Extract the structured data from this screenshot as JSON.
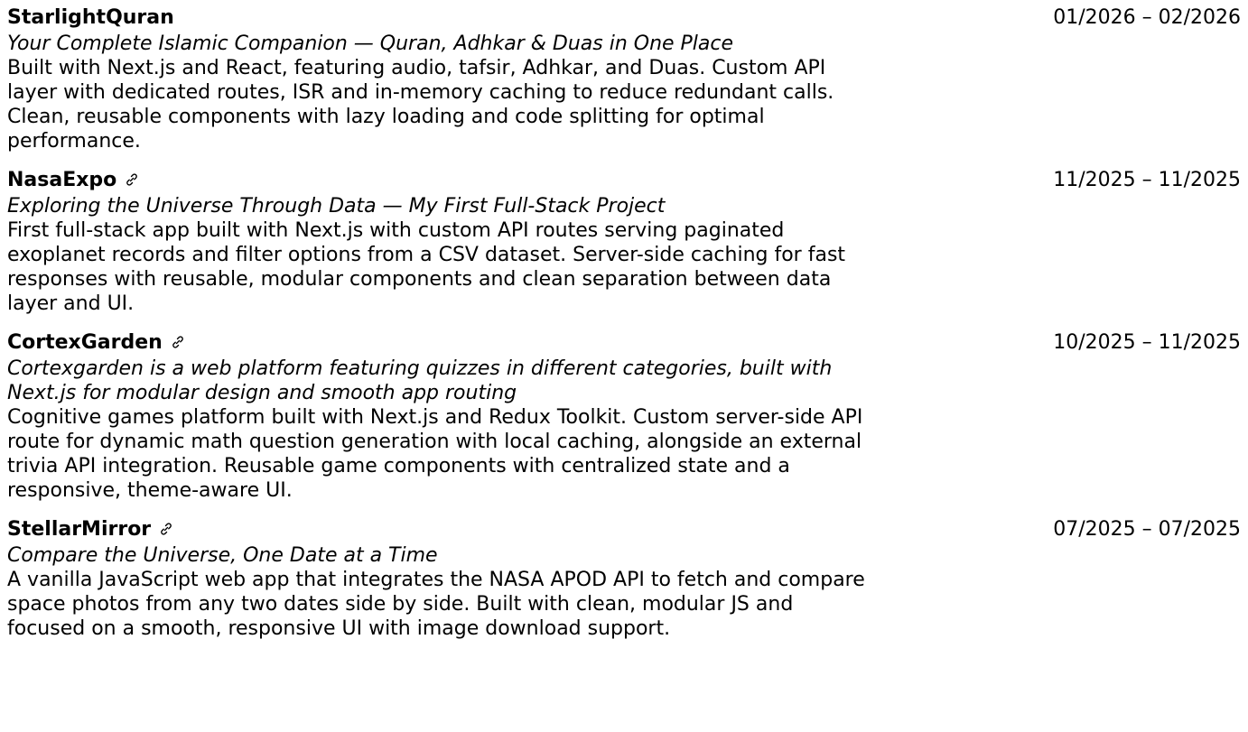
{
  "projects": [
    {
      "name": "StarlightQuran",
      "has_link": false,
      "dates": "01/2026 – 02/2026",
      "tagline": "Your Complete Islamic Companion — Quran, Adhkar & Duas in One Place",
      "description": "Built with Next.js and React, featuring audio, tafsir, Adhkar, and Duas. Custom API layer with dedicated routes, ISR and in-memory caching to reduce redundant calls. Clean, reusable components with lazy loading and code splitting for optimal performance."
    },
    {
      "name": "NasaExpo",
      "has_link": true,
      "dates": "11/2025 – 11/2025",
      "tagline": "Exploring the Universe Through Data — My First Full-Stack Project",
      "description": "First full-stack app built with Next.js with custom API routes serving paginated exoplanet records and filter options from a CSV dataset. Server-side caching for fast responses with reusable, modular components and clean separation between data layer and UI."
    },
    {
      "name": "CortexGarden",
      "has_link": true,
      "dates": "10/2025 – 11/2025",
      "tagline": "Cortexgarden is a web platform featuring quizzes in different categories, built with Next.js for modular design and smooth app routing",
      "description": "Cognitive games platform built with Next.js and Redux Toolkit. Custom server-side API route for dynamic math question generation with local caching, alongside an external trivia API integration. Reusable game components with centralized state and a responsive, theme-aware UI."
    },
    {
      "name": "StellarMirror",
      "has_link": true,
      "dates": "07/2025 – 07/2025",
      "tagline": "Compare the Universe, One Date at a Time",
      "description": "A vanilla JavaScript web app that integrates the NASA APOD API to fetch and compare space photos from any two dates side by side. Built with clean, modular JS and focused on a smooth, responsive UI with image download support."
    }
  ]
}
